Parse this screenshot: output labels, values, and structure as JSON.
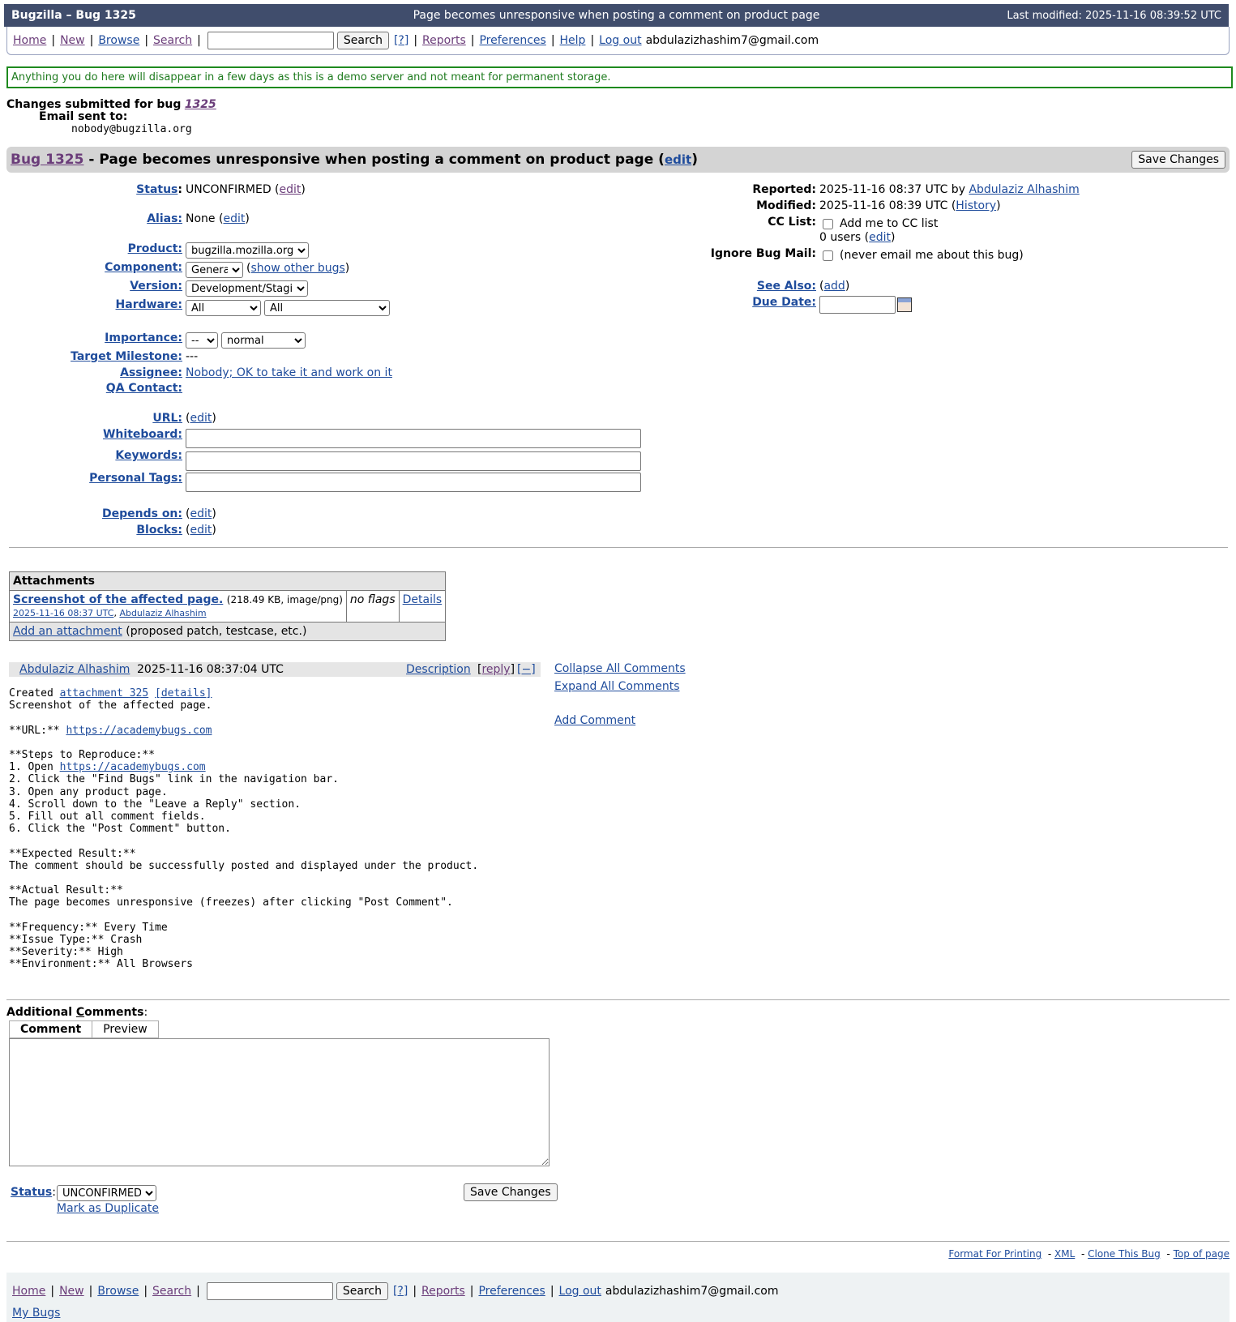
{
  "header": {
    "left": "Bugzilla – Bug 1325",
    "center": "Page becomes unresponsive when posting a comment on product page",
    "right": "Last modified: 2025-11-16 08:39:52 UTC"
  },
  "nav": {
    "home": "Home",
    "new": "New",
    "browse": "Browse",
    "search": "Search",
    "search_button": "Search",
    "help_q": "[?]",
    "reports": "Reports",
    "preferences": "Preferences",
    "help": "Help",
    "logout": "Log out",
    "user": "abdulazizhashim7@gmail.com",
    "my_bugs": "My Bugs",
    "sep": "|"
  },
  "demo_notice": "Anything you do here will disappear in a few days as this is a demo server and not meant for permanent storage.",
  "submitted": {
    "text": "Changes submitted for bug",
    "bug_link": "1325",
    "email_label": "Email sent to:",
    "email": "nobody@bugzilla.org"
  },
  "title": {
    "bug_link": "Bug 1325",
    "summary": "- Page becomes unresponsive when posting a comment on product page",
    "edit": "edit",
    "save": "Save Changes"
  },
  "fields": {
    "status": {
      "label": "Status",
      "value": "UNCONFIRMED",
      "edit": "edit"
    },
    "alias": {
      "label": "Alias:",
      "value": "None",
      "edit": "edit"
    },
    "product": {
      "label": "Product:",
      "value": "bugzilla.mozilla.org"
    },
    "component": {
      "label": "Component:",
      "value": "General",
      "other": "show other bugs"
    },
    "version": {
      "label": "Version:",
      "value": "Development/Staging"
    },
    "hardware": {
      "label": "Hardware:",
      "platform": "All",
      "os": "All"
    },
    "importance": {
      "label": "Importance:",
      "priority": "--",
      "severity": "normal"
    },
    "milestone": {
      "label": "Target Milestone:",
      "value": "---"
    },
    "assignee": {
      "label": "Assignee:",
      "value": "Nobody; OK to take it and work on it"
    },
    "qa": {
      "label": "QA Contact:"
    },
    "url": {
      "label": "URL:",
      "edit": "edit"
    },
    "whiteboard": {
      "label": "Whiteboard:"
    },
    "keywords": {
      "label": "Keywords:"
    },
    "tags": {
      "label": "Personal Tags:"
    },
    "depends": {
      "label": "Depends on:",
      "edit": "edit"
    },
    "blocks": {
      "label": "Blocks:",
      "edit": "edit"
    }
  },
  "right": {
    "reported_label": "Reported:",
    "reported": "2025-11-16 08:37 UTC by",
    "reporter": "Abdulaziz Alhashim",
    "modified_label": "Modified:",
    "modified": "2025-11-16 08:39 UTC",
    "history": "History",
    "cc_label": "CC List:",
    "cc_add": "Add me to CC list",
    "cc_count": "0 users",
    "cc_edit": "edit",
    "ignore_label": "Ignore Bug Mail:",
    "ignore_text": "(never email me about this bug)",
    "see_also_label": "See Also:",
    "see_also_add": "add",
    "due_label": "Due Date:"
  },
  "attachments": {
    "header": "Attachments",
    "name": "Screenshot of the affected page.",
    "meta": "(218.49 KB, image/png)",
    "date": "2025-11-16 08:37 UTC",
    "author": "Abdulaziz Alhashim",
    "flags": "no flags",
    "details": "Details",
    "add": "Add an attachment",
    "add_note": "(proposed patch, testcase, etc.)"
  },
  "comment": {
    "author": "Abdulaziz Alhashim",
    "time": "2025-11-16 08:37:04 UTC",
    "description": "Description",
    "reply": "reply",
    "collapse": "[−]",
    "created": "Created",
    "attachment_link": "attachment 325",
    "details_link": "[details]",
    "line_after": "Screenshot of the affected page.",
    "url_label": "**URL:**",
    "url": "https://academybugs.com",
    "steps_title": "**Steps to Reproduce:**",
    "step1": "1. Open",
    "steps_rest": "2. Click the \"Find Bugs\" link in the navigation bar.\n3. Open any product page.\n4. Scroll down to the \"Leave a Reply\" section.\n5. Fill out all comment fields.\n6. Click the \"Post Comment\" button.\n\n**Expected Result:**\nThe comment should be successfully posted and displayed under the product.\n\n**Actual Result:**\nThe page becomes unresponsive (freezes) after clicking \"Post Comment\".\n\n**Frequency:** Every Time\n**Issue Type:** Crash\n**Severity:** High\n**Environment:** All Browsers"
  },
  "side_links": {
    "collapse_all": "Collapse All Comments",
    "expand_all": "Expand All Comments",
    "add_comment": "Add Comment"
  },
  "additional": {
    "label_pre": "Additional ",
    "label_c": "C",
    "label_post": "omments",
    "colon": ":",
    "tab_comment": "Comment",
    "tab_preview": "Preview",
    "status_label": "Status",
    "status_value": "UNCONFIRMED",
    "duplicate": "Mark as Duplicate",
    "save": "Save Changes"
  },
  "footer_links": {
    "print": "Format For Printing",
    "xml": "XML",
    "clone": "Clone This Bug",
    "top": "Top of page",
    "dash": "-"
  }
}
